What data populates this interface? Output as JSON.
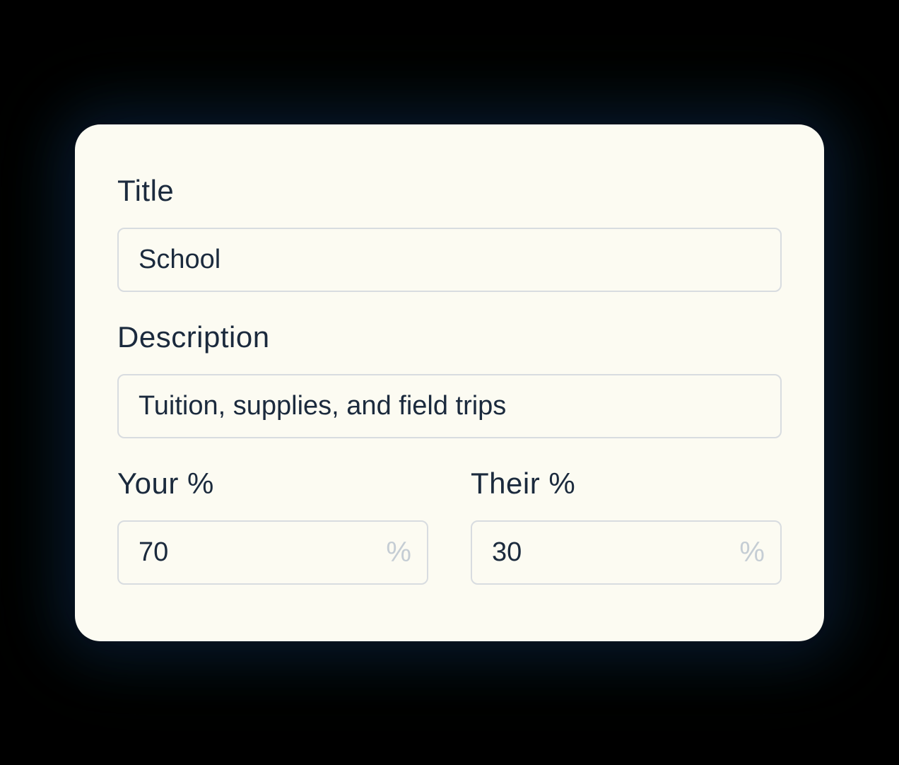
{
  "form": {
    "title_label": "Title",
    "title_value": "School",
    "description_label": "Description",
    "description_value": "Tuition, supplies, and field trips",
    "your_percent_label": "Your %",
    "your_percent_value": "70",
    "their_percent_label": "Their %",
    "their_percent_value": "30",
    "percent_symbol": "%"
  }
}
